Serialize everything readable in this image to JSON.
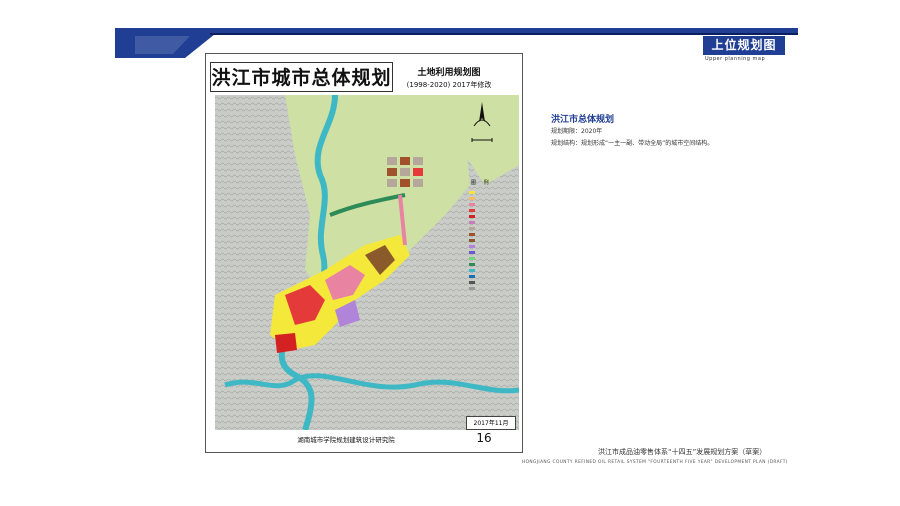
{
  "header": {
    "title": "上位规划图",
    "subtitle": "Upper planning map"
  },
  "map_sheet": {
    "main_title": "洪江市城市总体规划",
    "map_title": "土地利用规划图",
    "map_subtitle": "(1998-2020) 2017年修改",
    "legend_title": "图 例",
    "date": "2017年11月",
    "organization": "湖南城市学院规划建筑设计研究院",
    "page_number": "16"
  },
  "info": {
    "title": "洪江市总体规划",
    "line1": "规划期限：2020年",
    "line2": "规划结构：规划形成“一主一副、带动全局”的城市空间结构。"
  },
  "footer": {
    "title_cn": "洪江市成品油零售体系“十四五”发展规划方案（草案）",
    "title_en": "HONGJIANG COUNTY REFINED OIL RETAIL SYSTEM \"FOURTEENTH FIVE YEAR\" DEVELOPMENT PLAN (DRAFT)"
  },
  "colors": {
    "brand_blue": "#1f3e94",
    "accent_navy": "#0b1f5e"
  }
}
